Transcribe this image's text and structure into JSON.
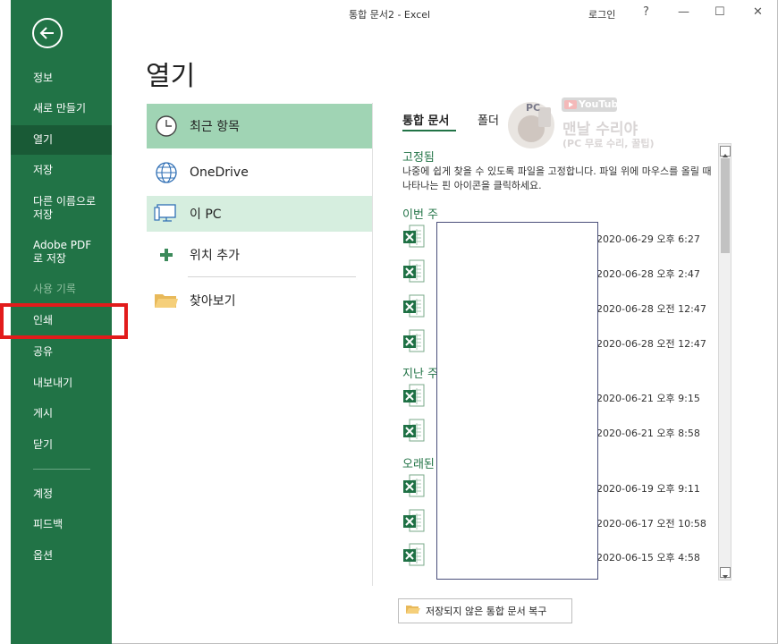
{
  "window": {
    "title": "통합 문서2  -  Excel",
    "login": "로그인",
    "help_glyph": "?",
    "minimize_glyph": "—",
    "maximize_glyph": "☐",
    "close_glyph": "✕"
  },
  "sidebar": {
    "items": [
      {
        "label": "정보"
      },
      {
        "label": "새로 만들기"
      },
      {
        "label": "열기"
      },
      {
        "label": "저장"
      },
      {
        "label": "다른 이름으로 저장"
      },
      {
        "label": "Adobe PDF로 저장"
      },
      {
        "label": "사용 기록"
      },
      {
        "label": "인쇄"
      },
      {
        "label": "공유"
      },
      {
        "label": "내보내기"
      },
      {
        "label": "게시"
      },
      {
        "label": "닫기"
      },
      {
        "label": "계정"
      },
      {
        "label": "피드백"
      },
      {
        "label": "옵션"
      }
    ],
    "selected": "열기",
    "highlighted": "인쇄",
    "accent_color": "#217346"
  },
  "page_title": "열기",
  "locations": [
    {
      "label": "최근 항목",
      "icon": "clock-icon"
    },
    {
      "label": "OneDrive",
      "icon": "globe-icon"
    },
    {
      "label": "이 PC",
      "icon": "computer-icon"
    },
    {
      "label": "위치 추가",
      "icon": "plus-icon"
    },
    {
      "label": "찾아보기",
      "icon": "folder-icon"
    }
  ],
  "tabs": [
    {
      "label": "통합 문서"
    },
    {
      "label": "폴더"
    }
  ],
  "watermark": {
    "badge": "PC",
    "youtube": "YouTube",
    "name": "맨날 수리야",
    "sub": "(PC 무료 수리, 꿀팁)"
  },
  "sections": {
    "pinned": "고정됨",
    "pinned_desc": "나중에 쉽게 찾을 수 있도록 파일을 고정합니다. 파일 위에 마우스를 올릴 때 나타나는 핀 아이콘을 클릭하세요.",
    "this_week": "이번 주",
    "last_week": "지난 주",
    "older": "오래된"
  },
  "files": [
    {
      "date": "2020-06-29 오후 6:27"
    },
    {
      "date": "2020-06-28 오후 2:47"
    },
    {
      "date": "2020-06-28 오전 12:47"
    },
    {
      "date": "2020-06-28 오전 12:47"
    },
    {
      "date": "2020-06-21 오후 9:15"
    },
    {
      "date": "2020-06-21 오후 8:58"
    },
    {
      "date": "2020-06-19 오후 9:11"
    },
    {
      "date": "2020-06-17 오전 10:58"
    },
    {
      "date": "2020-06-15 오후 4:58"
    }
  ],
  "recover_button": "저장되지 않은 통합 문서 복구"
}
